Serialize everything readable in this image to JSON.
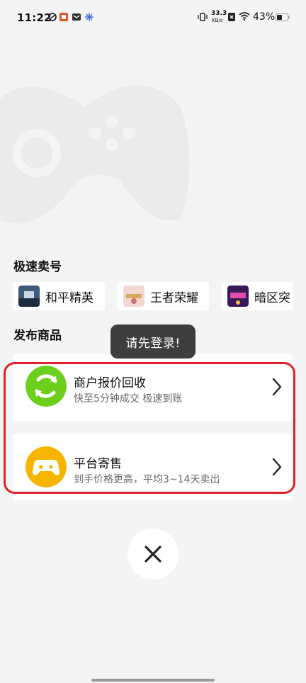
{
  "status_bar": {
    "time": "11:22",
    "net_speed_value": "33.3",
    "net_speed_unit": "KB/s",
    "battery": "43%",
    "icons": [
      "app-icon-swirl",
      "app-icon-orange-badge",
      "app-icon-mail",
      "app-icon-snowflake",
      "vibrate-icon",
      "sim-x-icon",
      "wifi-icon",
      "battery-icon"
    ]
  },
  "quick_sell": {
    "title": "极速卖号",
    "games": [
      {
        "label": "和平精英",
        "icon": "game-thumb-peace-elite"
      },
      {
        "label": "王者荣耀",
        "icon": "game-thumb-honor-of-kings"
      },
      {
        "label": "暗区突",
        "icon": "game-thumb-arena-breakout"
      }
    ]
  },
  "publish": {
    "title": "发布商品",
    "options": [
      {
        "title": "商户报价回收",
        "subtitle": "快至5分钟成交 极速到账",
        "icon": "recycle-icon",
        "color": "#6bcf1b"
      },
      {
        "title": "平台寄售",
        "subtitle": "到手价格更高，平均3~14天卖出",
        "icon": "gamepad-icon",
        "color": "#f7b500"
      }
    ]
  },
  "toast": {
    "text": "请先登录!"
  },
  "close": {
    "icon": "close-icon"
  },
  "colors": {
    "highlight": "#e0202a",
    "background": "#f4f4f4",
    "toast_bg": "#3e3e3e"
  }
}
